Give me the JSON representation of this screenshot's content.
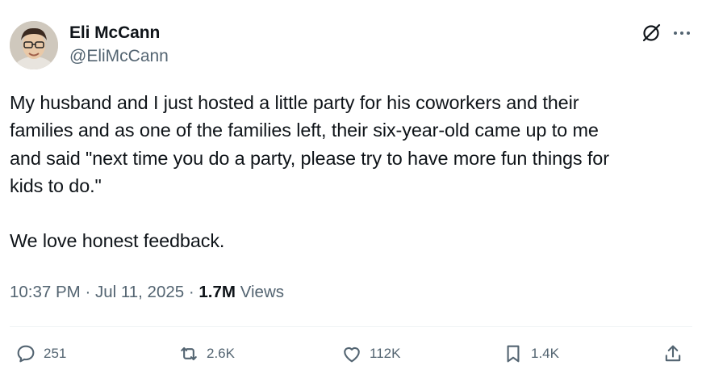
{
  "author": {
    "display_name": "Eli McCann",
    "handle": "@EliMcCann"
  },
  "header": {
    "grok_icon": "grok-slash-circle-icon",
    "more_icon": "more-dots-icon"
  },
  "tweet": {
    "text": "My husband and I just hosted a little party for his coworkers and their\nfamilies and as one of the families left, their six-year-old came up to me\nand said \"next time you do a party, please try to have more fun things for\nkids to do.\"\n\nWe love honest feedback."
  },
  "meta": {
    "time": "10:37 PM",
    "separator": "·",
    "date": "Jul 11, 2025",
    "views_count": "1.7M",
    "views_label": "Views"
  },
  "actions": {
    "reply_count": "251",
    "repost_count": "2.6K",
    "like_count": "112K",
    "bookmark_count": "1.4K"
  },
  "colors": {
    "text": "#0f1419",
    "secondary": "#536471",
    "divider": "#eff3f4"
  }
}
